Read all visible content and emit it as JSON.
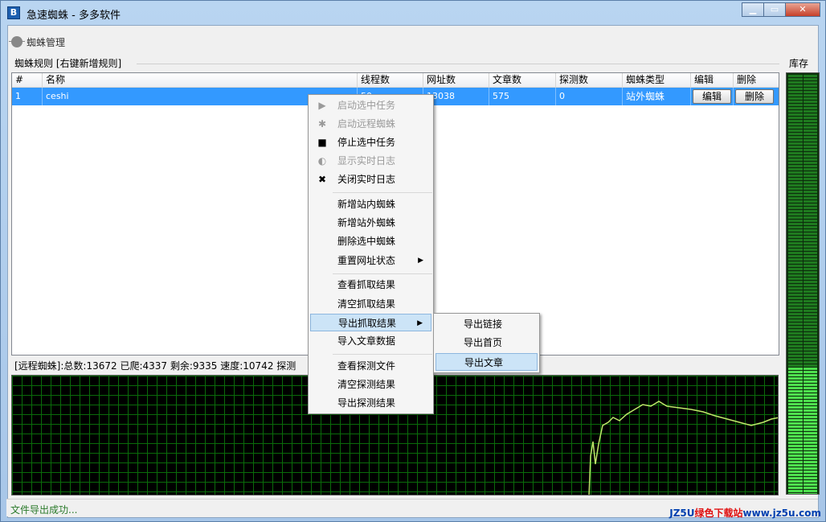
{
  "window": {
    "title": "急速蜘蛛 - 多多软件",
    "icon_text": "B"
  },
  "toolbar": {
    "spider_manage": "蜘蛛管理"
  },
  "rules_group": {
    "title": "蜘蛛规则 [右键新增规则]"
  },
  "grid": {
    "headers": [
      "#",
      "名称",
      "线程数",
      "网址数",
      "文章数",
      "探测数",
      "蜘蛛类型",
      "编辑",
      "删除"
    ],
    "rows": [
      {
        "num": "1",
        "name": "ceshi",
        "threads": "50",
        "urls": "13038",
        "articles": "575",
        "probes": "0",
        "type": "站外蜘蛛",
        "edit": "编辑",
        "delete": "删除"
      }
    ]
  },
  "status_line": "[远程蜘蛛]:总数:13672 已爬:4337 剩余:9335 速度:10742 探测",
  "stock_label": "库存",
  "stock_level": 0.3,
  "statusbar": {
    "message": "文件导出成功..."
  },
  "watermark": {
    "prefix": "JZ5U",
    "green": "绿色下载站",
    "url": "www.jz5u.com"
  },
  "context_menu": {
    "items": [
      {
        "label": "启动选中任务",
        "icon": "play-icon",
        "glyph": "▶",
        "disabled": true
      },
      {
        "label": "启动远程蜘蛛",
        "icon": "spider-icon",
        "glyph": "✱",
        "disabled": true
      },
      {
        "label": "停止选中任务",
        "icon": "stop-icon",
        "glyph": "■",
        "disabled": false
      },
      {
        "label": "显示实时日志",
        "icon": "toggle-icon",
        "glyph": "◐",
        "disabled": true
      },
      {
        "label": "关闭实时日志",
        "icon": "close-icon",
        "glyph": "✖",
        "disabled": false
      },
      {
        "label": "新增站内蜘蛛"
      },
      {
        "label": "新增站外蜘蛛"
      },
      {
        "label": "删除选中蜘蛛"
      },
      {
        "label": "重置网址状态",
        "submenu": true
      },
      {
        "label": "查看抓取结果"
      },
      {
        "label": "清空抓取结果"
      },
      {
        "label": "导出抓取结果",
        "submenu": true,
        "highlighted": true
      },
      {
        "label": "导入文章数据"
      },
      {
        "label": "查看探测文件"
      },
      {
        "label": "清空探测结果"
      },
      {
        "label": "导出探测结果"
      }
    ]
  },
  "export_submenu": {
    "items": [
      "导出链接",
      "导出首页",
      "导出文章"
    ],
    "highlighted_index": 2
  },
  "colors": {
    "selection": "#3399ff",
    "grid_green": "#0a6b0a",
    "trace": "#bfe86a"
  }
}
